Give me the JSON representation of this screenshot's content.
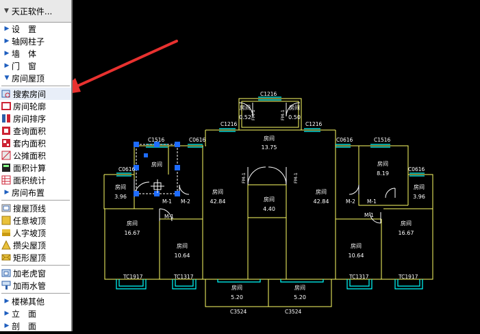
{
  "sidebar": {
    "title": "天正软件...",
    "groups1": [
      {
        "label": "设　置",
        "icon": "chevron-right-icon"
      },
      {
        "label": "轴网柱子",
        "icon": "chevron-right-icon"
      },
      {
        "label": "墙　体",
        "icon": "chevron-right-icon"
      },
      {
        "label": "门　窗",
        "icon": "chevron-right-icon"
      },
      {
        "label": "房间屋顶",
        "icon": "chevron-down-icon"
      }
    ],
    "room_tools": [
      {
        "label": "搜索房间",
        "icon": "search-room-icon"
      },
      {
        "label": "房间轮廓",
        "icon": "room-outline-icon"
      },
      {
        "label": "房间排序",
        "icon": "room-sort-icon"
      },
      {
        "label": "查询面积",
        "icon": "query-area-icon"
      },
      {
        "label": "套内面积",
        "icon": "suite-area-icon"
      },
      {
        "label": "公摊面积",
        "icon": "shared-area-icon"
      },
      {
        "label": "面积计算",
        "icon": "area-calc-icon"
      },
      {
        "label": "面积统计",
        "icon": "area-stats-icon"
      },
      {
        "label": "房间布置",
        "icon": "chevron-right-icon"
      }
    ],
    "roof_tools": [
      {
        "label": "搜屋顶线",
        "icon": "roof-line-icon"
      },
      {
        "label": "任意坡顶",
        "icon": "any-slope-roof-icon"
      },
      {
        "label": "人字坡顶",
        "icon": "gable-roof-icon"
      },
      {
        "label": "攒尖屋顶",
        "icon": "pyramid-roof-icon"
      },
      {
        "label": "矩形屋顶",
        "icon": "rect-roof-icon"
      }
    ],
    "other_tools": [
      {
        "label": "加老虎窗",
        "icon": "dormer-icon"
      },
      {
        "label": "加雨水管",
        "icon": "rain-pipe-icon"
      }
    ],
    "groups2": [
      {
        "label": "楼梯其他",
        "icon": "chevron-right-icon"
      },
      {
        "label": "立　面",
        "icon": "chevron-right-icon"
      },
      {
        "label": "剖　面",
        "icon": "chevron-right-icon"
      }
    ]
  },
  "drawing": {
    "colors": {
      "wall": "#ffff66",
      "window": "#00ffff",
      "door": "#ffffff",
      "text": "#ffffff",
      "grip": "#1e6cff",
      "arrow": "#e8312f"
    },
    "labels": {
      "c1216_top": "C1216",
      "c1216_left": "C1216",
      "c1216_right": "C1216",
      "c1516_left": "C1516",
      "c1516_right": "C1516",
      "c0616_a": "C0616",
      "c0616_b": "C0616",
      "c0616_c": "C0616",
      "c0616_d": "C0616",
      "tc1917_left": "TC1917",
      "tc1317_left": "TC1317",
      "tc1317_right": "TC1317",
      "tc1917_right": "TC1917",
      "c3524_left": "C3524",
      "c3524_right": "C3524",
      "m2_a": "M-2",
      "m2_b": "M-2",
      "m1_a": "M-1",
      "m1_b": "M-1",
      "m1_c": "M-1",
      "m1_d": "M-1",
      "fm_a": "FM-1",
      "fm_b": "FM-1",
      "fm_c": "FM-1",
      "fm_d": "FM-1"
    },
    "rooms": [
      {
        "name": "房间",
        "area": "0.52"
      },
      {
        "name": "房间",
        "area": "0.50"
      },
      {
        "name": "房间",
        "area": "13.75"
      },
      {
        "name": "房间",
        "area": "4.40"
      },
      {
        "name": "房间",
        "area": "42.84"
      },
      {
        "name": "房间",
        "area": "42.84"
      },
      {
        "name": "房间",
        "area": "3.96"
      },
      {
        "name": "房间",
        "area": "3.96"
      },
      {
        "name": "房间",
        "area": "8.19"
      },
      {
        "name": "房间",
        "area": "16.67"
      },
      {
        "name": "房间",
        "area": "16.67"
      },
      {
        "name": "房间",
        "area": "10.64"
      },
      {
        "name": "房间",
        "area": "10.64"
      },
      {
        "name": "房间",
        "area": "5.20"
      },
      {
        "name": "房间",
        "area": "5.20"
      },
      {
        "name": "房间",
        "area": ""
      }
    ]
  }
}
